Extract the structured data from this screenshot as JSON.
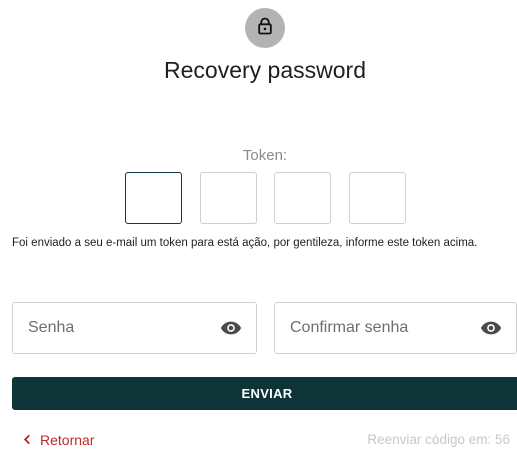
{
  "title": "Recovery password",
  "token": {
    "label": "Token:",
    "digits": [
      "",
      "",
      "",
      ""
    ]
  },
  "info_text": "Foi enviado a seu e-mail um token para está ação, por gentileza, informe este token acima.",
  "fields": {
    "password_placeholder": "Senha",
    "confirm_placeholder": "Confirmar senha"
  },
  "buttons": {
    "send_label": "ENVIAR",
    "back_label": "Retornar"
  },
  "resend_text": "Reenviar código em: 56",
  "icons": {
    "lock": "lock-icon",
    "eye": "eye-icon",
    "back": "chevron-left-icon"
  },
  "colors": {
    "primary": "#0d3436",
    "back_link": "#c02828",
    "lock_bg": "#b3b3b3"
  }
}
